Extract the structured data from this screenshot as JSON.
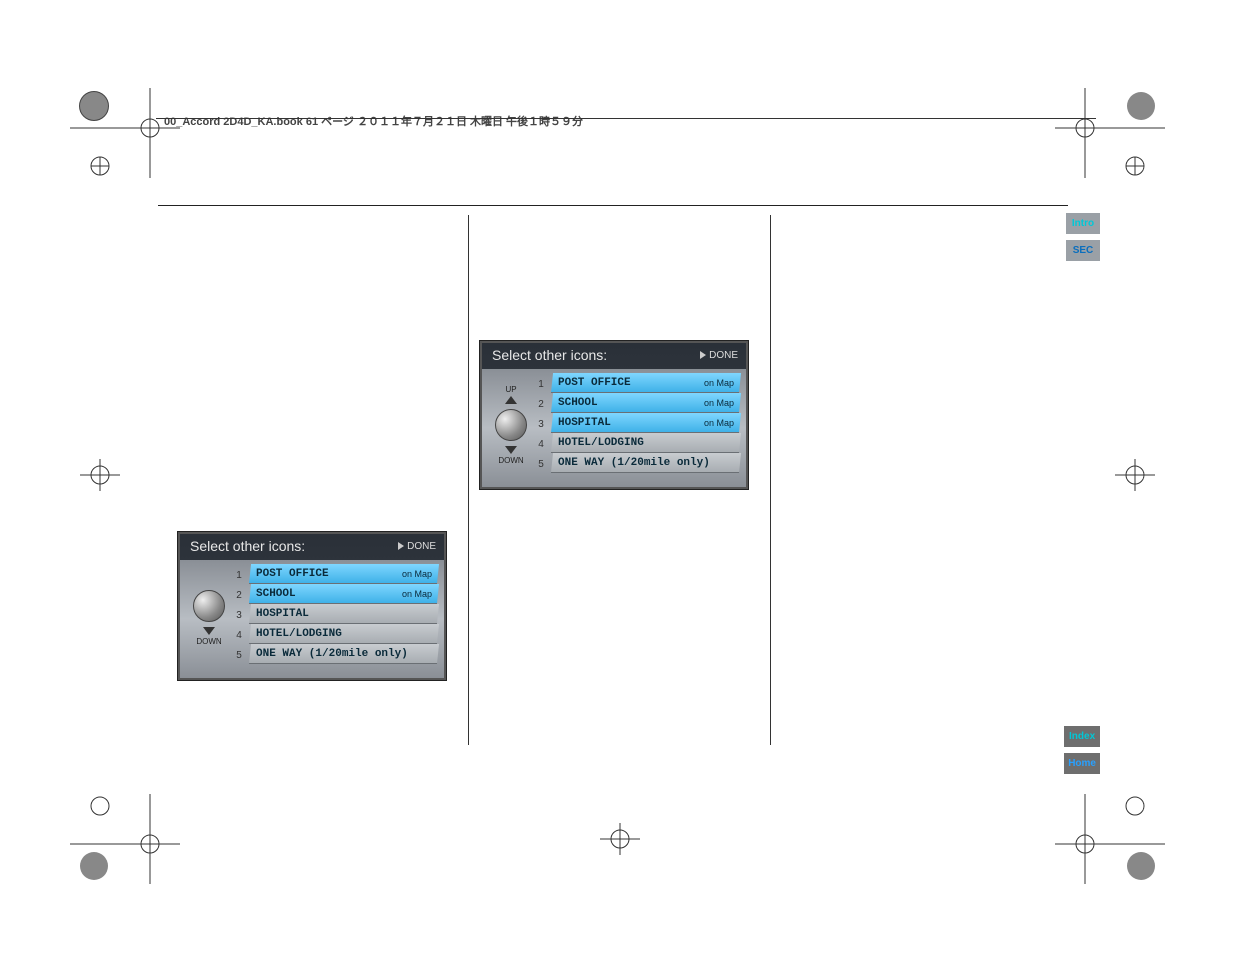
{
  "header": {
    "text": "00_Accord 2D4D_KA.book  61 ページ  ２０１１年７月２１日  木曜日  午後１時５９分"
  },
  "tabs": {
    "intro": "Intro",
    "sec": "SEC",
    "index": "Index",
    "home": "Home"
  },
  "nav": {
    "title": "Select other icons:",
    "done": "DONE",
    "up": "UP",
    "down": "DOWN",
    "badge": "on Map",
    "rows": {
      "r1": "POST OFFICE",
      "r2": "SCHOOL",
      "r3": "HOSPITAL",
      "r4": "HOTEL/LODGING",
      "r5": "ONE WAY (1/20mile only)"
    },
    "nums": {
      "n1": "1",
      "n2": "2",
      "n3": "3",
      "n4": "4",
      "n5": "5"
    },
    "shotA_on": [
      true,
      true,
      false,
      false,
      false
    ],
    "shotB_on": [
      true,
      true,
      true,
      false,
      false
    ]
  }
}
